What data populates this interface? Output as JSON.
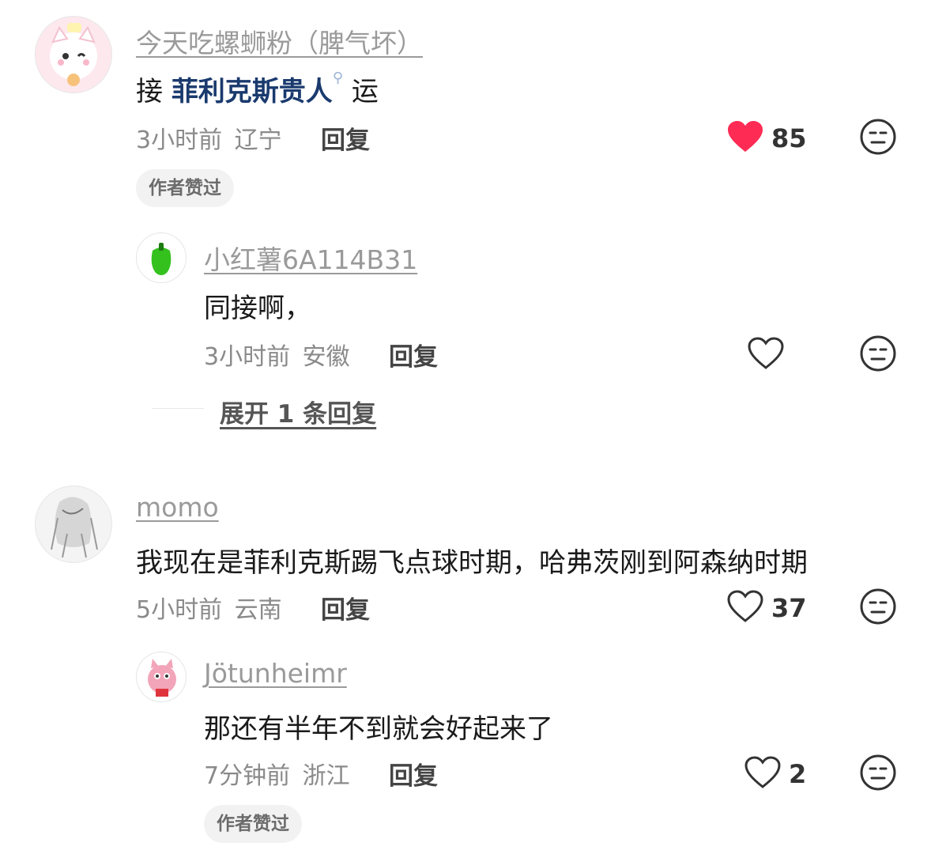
{
  "comments": [
    {
      "username": "今天吃螺蛳粉（脾气坏）",
      "text_before": "接",
      "text_link": "菲利克斯贵人",
      "text_after": "运",
      "time": "3小时前",
      "location": "辽宁",
      "reply_label": "回复",
      "likes": "85",
      "liked": true,
      "badge": "作者赞过",
      "replies": [
        {
          "username": "小红薯6A114B31",
          "text": "同接啊，",
          "time": "3小时前",
          "location": "安徽",
          "reply_label": "回复",
          "likes": ""
        }
      ],
      "expand_label": "展开 1 条回复"
    },
    {
      "username": "momo",
      "text": "我现在是菲利克斯踢飞点球时期，哈弗茨刚到阿森纳时期",
      "time": "5小时前",
      "location": "云南",
      "reply_label": "回复",
      "likes": "37",
      "liked": false,
      "replies": [
        {
          "username": "Jötunheimr",
          "text": "那还有半年不到就会好起来了",
          "time": "7分钟前",
          "location": "浙江",
          "reply_label": "回复",
          "likes": "2",
          "badge": "作者赞过"
        }
      ]
    }
  ],
  "colors": {
    "liked_heart": "#fe2c55",
    "link": "#1a3a6e",
    "muted": "#8a8a8a"
  },
  "icons": {
    "heart": "heart-icon",
    "heart_filled": "heart-filled-icon",
    "dislike": "unamused-face-icon",
    "search": "search-icon"
  }
}
